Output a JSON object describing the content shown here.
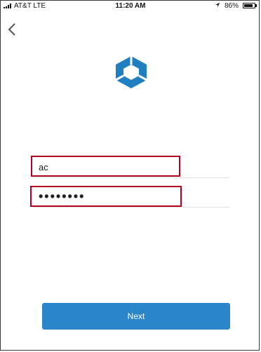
{
  "status_bar": {
    "carrier": "AT&T  LTE",
    "time": "11:20 AM",
    "battery_percent": "86%",
    "location_icon": "location-arrow-icon",
    "signal_icon": "signal-bars-icon",
    "battery_icon": "battery-icon"
  },
  "nav": {
    "back_icon": "chevron-left-icon"
  },
  "logo": {
    "icon": "app-hexagon-logo",
    "color": "#1f7fc0"
  },
  "form": {
    "username_value": "ac",
    "password_value": "••••••••"
  },
  "actions": {
    "next_label": "Next"
  },
  "colors": {
    "accent": "#2a86c8",
    "highlight": "#b00020"
  }
}
